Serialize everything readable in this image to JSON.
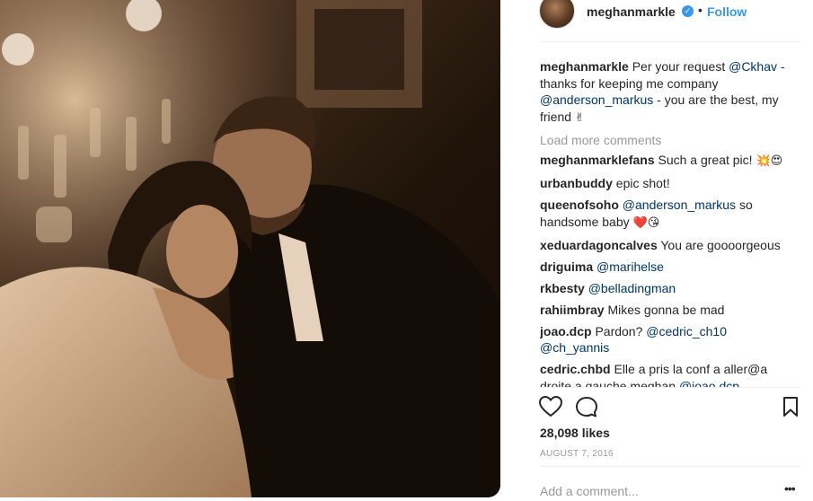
{
  "post": {
    "author": "meghanmarkle",
    "follow_label": "Follow",
    "separator": "•",
    "verified_glyph": "✓",
    "photo_alt": "Photo by meghanmarkle"
  },
  "caption": {
    "user": "meghanmarkle",
    "text_1": "Per your request ",
    "mention_1": "@Ckhav",
    "text_2": " - thanks for keeping me company ",
    "mention_2": "@anderson_markus",
    "text_3": " - you are the best, my friend ",
    "emoji": "✌"
  },
  "load_more": "Load more comments",
  "comments": [
    {
      "user": "meghanmarklefans",
      "text": "Such a great pic! ",
      "emoji": "💥😍"
    },
    {
      "user": "urbanbuddy",
      "text": "epic shot!"
    },
    {
      "user": "queenofsoho",
      "mention": "@anderson_markus",
      "text": " so handsome baby ",
      "emoji": "❤️😘"
    },
    {
      "user": "xeduardagoncalves",
      "text": "You are goooorgeous"
    },
    {
      "user": "driguima",
      "mention": "@marihelse"
    },
    {
      "user": "rkbesty",
      "mention": "@belladingman"
    },
    {
      "user": "rahiimbray",
      "text": "Mikes gonna be mad"
    },
    {
      "user": "joao.dcp",
      "text": "Pardon? ",
      "mention": "@cedric_ch10",
      "mention_2": "@ch_yannis"
    },
    {
      "user": "cedric.chbd",
      "text": "Elle a pris la conf a aller@a droite a gauche meghan ",
      "mention": "@joao.dcp"
    }
  ],
  "icons": {
    "like": "heart-icon",
    "comment": "comment-bubble-icon",
    "save": "bookmark-icon",
    "more": "more-options-icon"
  },
  "likes": "28,098 likes",
  "date": "AUGUST 7, 2016",
  "add_comment_placeholder": "Add a comment...",
  "more_glyph": "•••",
  "colors": {
    "link_blue": "#3897f0",
    "mention": "#003569",
    "muted": "#999999",
    "text": "#262626"
  }
}
